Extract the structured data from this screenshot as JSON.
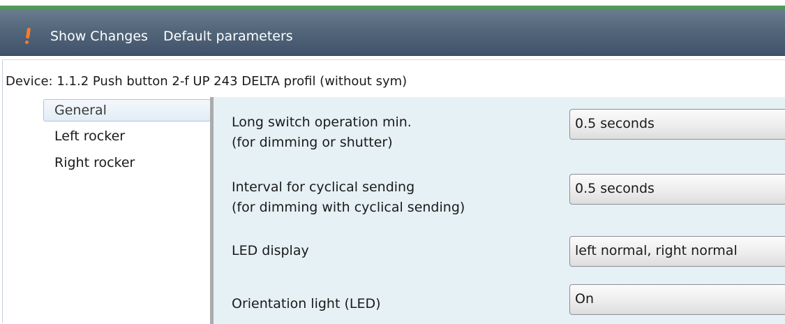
{
  "toolbar": {
    "show_changes": "Show Changes",
    "default_parameters": "Default parameters",
    "warning_icon": "exclamation-icon",
    "accent_color": "#ff7a2a"
  },
  "device": {
    "title": "Device: 1.1.2  Push button 2-f UP 243 DELTA profil (without sym)"
  },
  "nav": {
    "items": [
      {
        "label": "General",
        "selected": true
      },
      {
        "label": "Left rocker",
        "selected": false
      },
      {
        "label": "Right rocker",
        "selected": false
      }
    ]
  },
  "params": [
    {
      "label_line1": "Long switch operation min.",
      "label_line2": "(for dimming or shutter)",
      "value": "0.5 seconds"
    },
    {
      "label_line1": "Interval for cyclical sending",
      "label_line2": "(for dimming with cyclical sending)",
      "value": "0.5 seconds"
    },
    {
      "label_line1": "LED display",
      "label_line2": "",
      "value": "left normal, right normal"
    },
    {
      "label_line1": "Orientation light (LED)",
      "label_line2": "",
      "value": "On"
    }
  ],
  "colors": {
    "toolbar_top": "#6b7d8f",
    "toolbar_bottom": "#40526a",
    "accent_green": "#4f9a57",
    "param_background": "#e6f1f6",
    "nav_selected_border": "#a9c4e0"
  }
}
